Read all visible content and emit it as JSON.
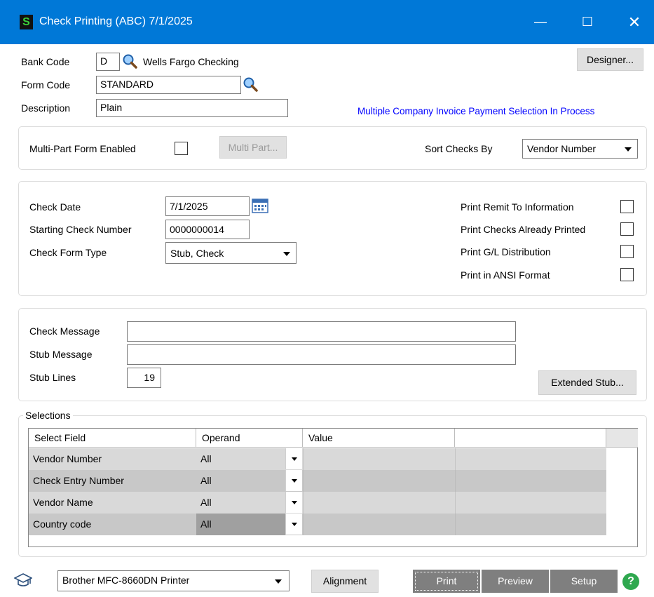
{
  "window": {
    "title": "Check Printing (ABC) 7/1/2025",
    "app_icon": "S",
    "controls": {
      "minimize": "—",
      "maximize": "☐",
      "close": "✕"
    }
  },
  "header": {
    "bank_code_label": "Bank Code",
    "bank_code_value": "D",
    "bank_name": "Wells Fargo Checking",
    "form_code_label": "Form Code",
    "form_code_value": "STANDARD",
    "description_label": "Description",
    "description_value": "Plain",
    "designer_button": "Designer...",
    "status_text": "Multiple Company Invoice Payment Selection In Process"
  },
  "form_options": {
    "multipart_label": "Multi-Part Form Enabled",
    "multipart_button": "Multi Part...",
    "sort_label": "Sort Checks By",
    "sort_value": "Vendor Number"
  },
  "check_options": {
    "check_date_label": "Check Date",
    "check_date_value": "7/1/2025",
    "starting_number_label": "Starting Check Number",
    "starting_number_value": "0000000014",
    "form_type_label": "Check Form Type",
    "form_type_value": "Stub, Check",
    "print_remit_label": "Print Remit To Information",
    "print_already_label": "Print Checks Already Printed",
    "print_gl_label": "Print G/L Distribution",
    "print_ansi_label": "Print in ANSI Format"
  },
  "messages": {
    "check_message_label": "Check Message",
    "check_message_value": "",
    "stub_message_label": "Stub Message",
    "stub_message_value": "",
    "stub_lines_label": "Stub Lines",
    "stub_lines_value": "19",
    "extended_stub_button": "Extended Stub..."
  },
  "selections": {
    "legend": "Selections",
    "columns": [
      "Select Field",
      "Operand",
      "Value"
    ],
    "rows": [
      {
        "field": "Vendor Number",
        "operand": "All",
        "value": ""
      },
      {
        "field": "Check Entry Number",
        "operand": "All",
        "value": ""
      },
      {
        "field": "Vendor Name",
        "operand": "All",
        "value": ""
      },
      {
        "field": "Country code",
        "operand": "All",
        "value": ""
      }
    ]
  },
  "footer": {
    "printer_value": "Brother MFC-8660DN Printer",
    "alignment_button": "Alignment",
    "print_button": "Print",
    "preview_button": "Preview",
    "setup_button": "Setup",
    "help_icon": "?"
  },
  "colors": {
    "titlebar": "#0078d7",
    "status_text": "#0000ff",
    "dark_button": "#7f7f7f",
    "row_a": "#d9d9d9",
    "row_b": "#c8c8c8",
    "operand_selected": "#a0a0a0"
  }
}
